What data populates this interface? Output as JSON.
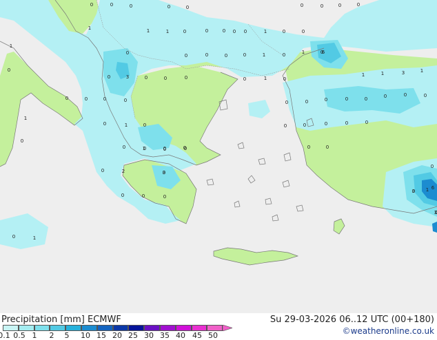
{
  "footer": {
    "title": "Precipitation [mm]  ECMWF",
    "time": "Su 29-03-2026 06..12 UTC (00+180)",
    "credit": "©weatheronline.co.uk"
  },
  "legend": {
    "labels": [
      "0.1",
      "0.5",
      "1",
      "2",
      "5",
      "10",
      "15",
      "20",
      "25",
      "30",
      "35",
      "40",
      "45",
      "50"
    ],
    "colors": [
      "#c8f4f4",
      "#a4ecf0",
      "#7ee0ec",
      "#52cae4",
      "#28b2dc",
      "#1c8cd0",
      "#1464c0",
      "#0c38a8",
      "#06149a",
      "#6a10c4",
      "#a010d0",
      "#d010d8",
      "#e830d0",
      "#f060c8"
    ]
  },
  "map_labels": [
    {
      "text": "0"
    },
    {
      "text": "0"
    },
    {
      "text": "0"
    },
    {
      "text": "0"
    },
    {
      "text": "0"
    },
    {
      "text": "0"
    },
    {
      "text": "0"
    },
    {
      "text": "0"
    },
    {
      "text": "0"
    },
    {
      "text": "0"
    },
    {
      "text": "1"
    },
    {
      "text": "1"
    },
    {
      "text": "1"
    },
    {
      "text": "0"
    },
    {
      "text": "0"
    },
    {
      "text": "0"
    },
    {
      "text": "0"
    },
    {
      "text": "1"
    },
    {
      "text": "0"
    },
    {
      "text": "0"
    },
    {
      "text": "1"
    },
    {
      "text": "0"
    },
    {
      "text": "0"
    },
    {
      "text": "0"
    },
    {
      "text": "0"
    },
    {
      "text": "0"
    },
    {
      "text": "1"
    },
    {
      "text": "0"
    },
    {
      "text": "1"
    },
    {
      "text": "0"
    },
    {
      "text": "6"
    },
    {
      "text": "0"
    },
    {
      "text": "3"
    },
    {
      "text": "0"
    },
    {
      "text": "0"
    },
    {
      "text": "0"
    },
    {
      "text": "0"
    },
    {
      "text": "1"
    },
    {
      "text": "0"
    },
    {
      "text": "1"
    },
    {
      "text": "1"
    },
    {
      "text": "3"
    },
    {
      "text": "1"
    },
    {
      "text": "0"
    },
    {
      "text": "0"
    },
    {
      "text": "0"
    },
    {
      "text": "0"
    },
    {
      "text": "0"
    },
    {
      "text": "0"
    },
    {
      "text": "0"
    },
    {
      "text": "0"
    },
    {
      "text": "0"
    },
    {
      "text": "0"
    },
    {
      "text": "0"
    },
    {
      "text": "0"
    },
    {
      "text": "0"
    },
    {
      "text": "1"
    },
    {
      "text": "0"
    },
    {
      "text": "1"
    },
    {
      "text": "0"
    },
    {
      "text": "0"
    },
    {
      "text": "0"
    },
    {
      "text": "0"
    },
    {
      "text": "0"
    },
    {
      "text": "0"
    },
    {
      "text": "0"
    },
    {
      "text": "0"
    },
    {
      "text": "0"
    },
    {
      "text": "0"
    },
    {
      "text": "0"
    },
    {
      "text": "0"
    },
    {
      "text": "0"
    },
    {
      "text": "0"
    },
    {
      "text": "2"
    },
    {
      "text": "1"
    },
    {
      "text": "0"
    },
    {
      "text": "0"
    },
    {
      "text": "0"
    },
    {
      "text": "0"
    },
    {
      "text": "0"
    },
    {
      "text": "0"
    },
    {
      "text": "3"
    },
    {
      "text": "0"
    },
    {
      "text": "1"
    },
    {
      "text": "0"
    },
    {
      "text": "0"
    },
    {
      "text": "0"
    },
    {
      "text": "1"
    },
    {
      "text": "3"
    },
    {
      "text": "6"
    },
    {
      "text": "3"
    }
  ]
}
